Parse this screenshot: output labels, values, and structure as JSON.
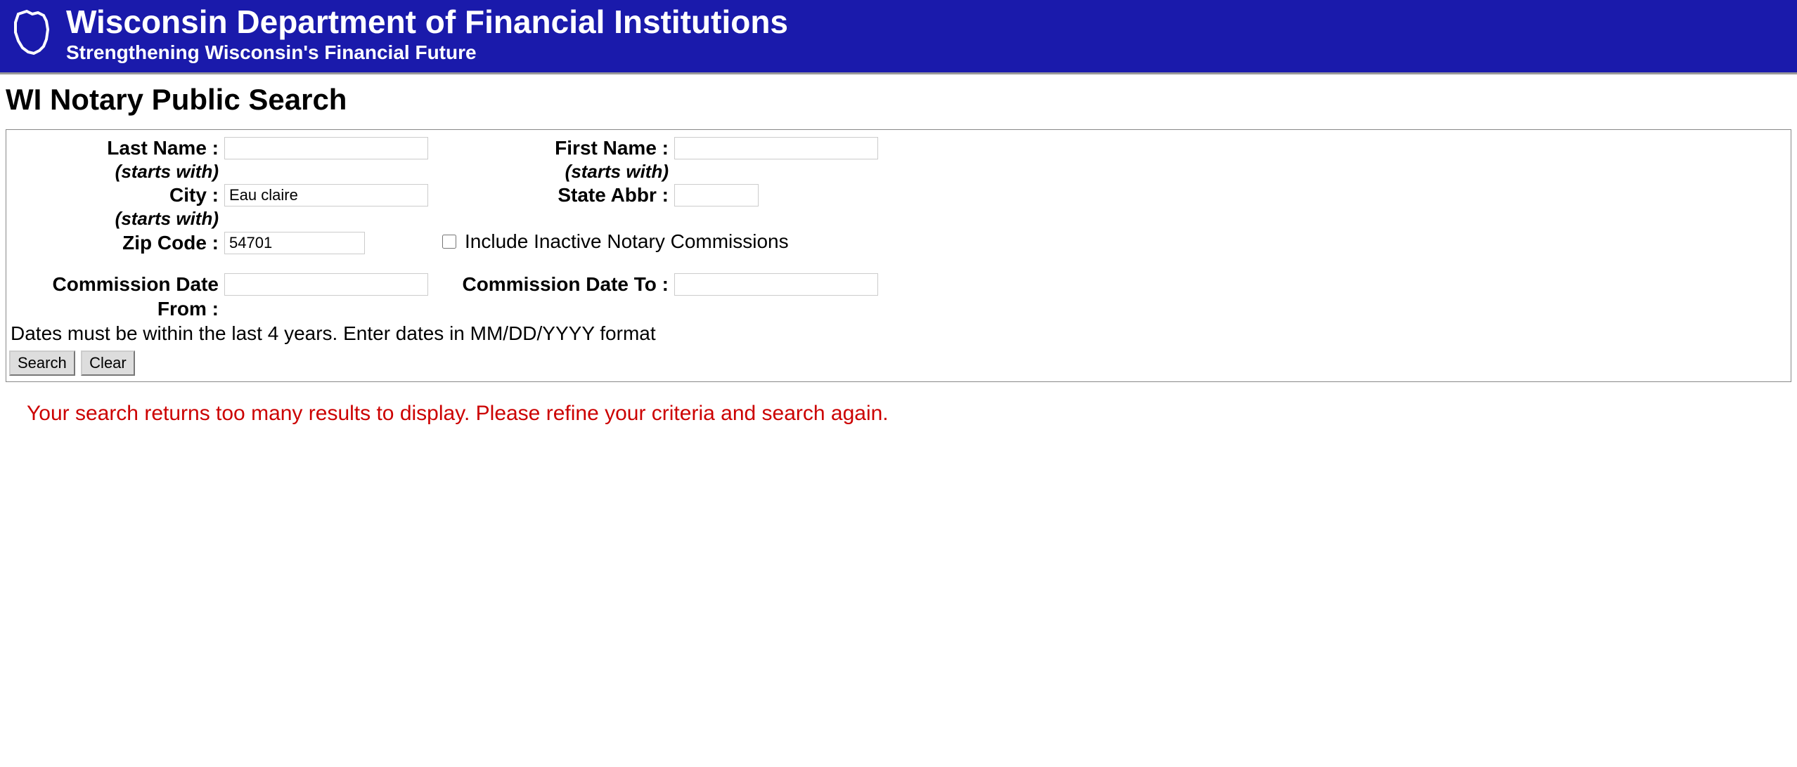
{
  "header": {
    "title": "Wisconsin Department of Financial Institutions",
    "subtitle": "Strengthening Wisconsin's Financial Future"
  },
  "page": {
    "title": "WI Notary Public Search"
  },
  "form": {
    "last_name": {
      "label": "Last Name :",
      "hint": "(starts with)",
      "value": ""
    },
    "first_name": {
      "label": "First Name :",
      "hint": "(starts with)",
      "value": ""
    },
    "city": {
      "label": "City :",
      "hint": "(starts with)",
      "value": "Eau claire"
    },
    "state": {
      "label": "State Abbr :",
      "value": ""
    },
    "zip": {
      "label": "Zip Code :",
      "value": "54701"
    },
    "include_inactive": {
      "label": "Include Inactive Notary Commissions",
      "checked": false
    },
    "date_from": {
      "label": "Commission Date From :",
      "value": ""
    },
    "date_to": {
      "label": "Commission Date To :",
      "value": ""
    },
    "date_note": "Dates must be within the last 4 years. Enter dates in MM/DD/YYYY format",
    "buttons": {
      "search": "Search",
      "clear": "Clear"
    }
  },
  "message": "Your search returns too many results to display. Please refine your criteria and search again."
}
